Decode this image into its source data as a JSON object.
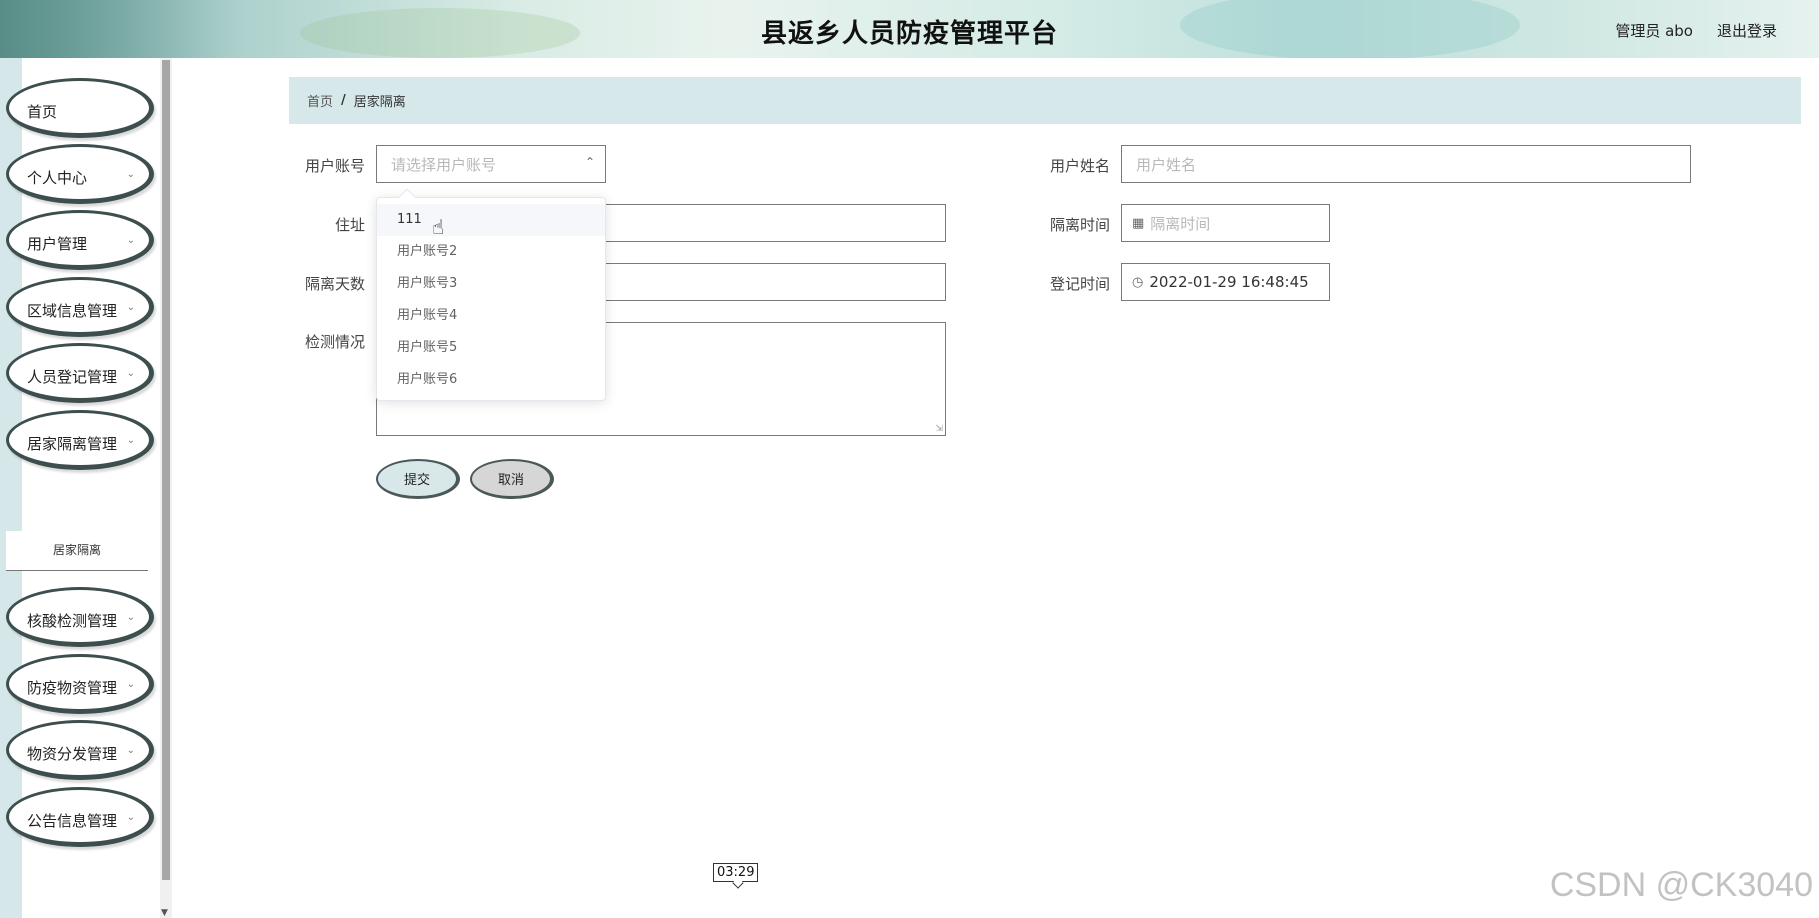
{
  "header": {
    "title": "县返乡人员防疫管理平台",
    "admin": "管理员 abo",
    "logout": "退出登录"
  },
  "sidebar": {
    "items": [
      {
        "label": "首页",
        "has_chevron": false
      },
      {
        "label": "个人中心",
        "has_chevron": true
      },
      {
        "label": "用户管理",
        "has_chevron": true
      },
      {
        "label": "区域信息管理",
        "has_chevron": true
      },
      {
        "label": "人员登记管理",
        "has_chevron": true
      },
      {
        "label": "居家隔离管理",
        "has_chevron": true
      },
      {
        "label": "核酸检测管理",
        "has_chevron": true
      },
      {
        "label": "防疫物资管理",
        "has_chevron": true
      },
      {
        "label": "物资分发管理",
        "has_chevron": true
      },
      {
        "label": "公告信息管理",
        "has_chevron": true
      }
    ],
    "sub_item": "居家隔离"
  },
  "breadcrumb": {
    "home": "首页",
    "separator": "/",
    "current": "居家隔离"
  },
  "form": {
    "account_label": "用户账号",
    "account_placeholder": "请选择用户账号",
    "name_label": "用户姓名",
    "name_placeholder": "用户姓名",
    "address_label": "住址",
    "isolation_time_label": "隔离时间",
    "isolation_time_placeholder": "隔离时间",
    "days_label": "隔离天数",
    "register_time_label": "登记时间",
    "register_time_value": "2022-01-29 16:48:45",
    "test_label": "检测情况",
    "submit": "提交",
    "cancel": "取消"
  },
  "dropdown": {
    "options": [
      "111",
      "用户账号2",
      "用户账号3",
      "用户账号4",
      "用户账号5",
      "用户账号6"
    ],
    "hovered": "111"
  },
  "video_time": "03:29",
  "watermark": "CSDN @CK3040",
  "icons": {
    "calendar": "calendar-icon",
    "clock": "clock-icon",
    "pointer": "hand-pointer-icon"
  }
}
